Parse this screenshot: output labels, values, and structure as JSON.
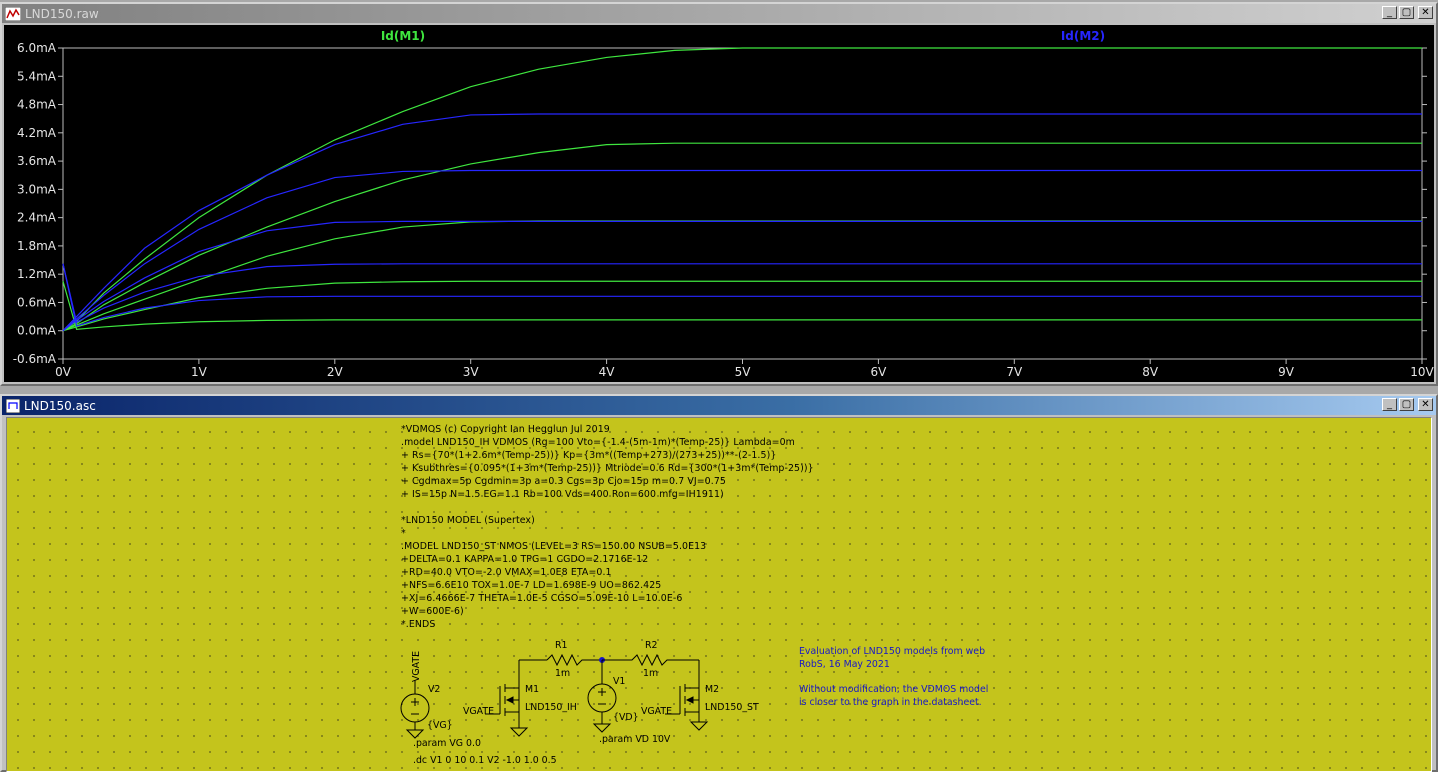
{
  "colors": {
    "trace_m1": "#3fe63f",
    "trace_m2": "#2626ff",
    "plot_bg": "#000000",
    "schematic_bg": "#c4c41c",
    "note": "#1717c8"
  },
  "plot_window": {
    "title": "LND150.raw",
    "icon": "waveform-icon",
    "buttons": {
      "minimize": "_",
      "restore": "▢",
      "close": "✕"
    }
  },
  "chart_data": {
    "type": "line",
    "xlim": [
      0,
      10
    ],
    "ylim": [
      -0.6,
      6.0
    ],
    "xticks": [
      "0V",
      "1V",
      "2V",
      "3V",
      "4V",
      "5V",
      "6V",
      "7V",
      "8V",
      "9V",
      "10V"
    ],
    "yticks": [
      "6.0mA",
      "5.4mA",
      "4.8mA",
      "4.2mA",
      "3.6mA",
      "3.0mA",
      "2.4mA",
      "1.8mA",
      "1.2mA",
      "0.6mA",
      "0.0mA",
      "-0.6mA"
    ],
    "x_values": [
      0,
      0.1,
      0.3,
      0.6,
      1.0,
      1.5,
      2.0,
      2.5,
      3.0,
      3.5,
      4.0,
      4.5,
      5.0,
      5.5,
      6.0,
      7.0,
      8.0,
      9.0,
      10.0
    ],
    "series": [
      {
        "name": "Id(M1)",
        "color": "#3fe63f",
        "values": [
          0,
          0.2,
          0.8,
          1.52,
          2.4,
          3.3,
          4.05,
          4.65,
          5.18,
          5.55,
          5.8,
          5.95,
          6.0,
          6.0,
          6.0,
          6.0,
          6.0,
          6.0,
          6.0
        ]
      },
      {
        "name": "Id(M1)",
        "color": "#3fe63f",
        "values": [
          0,
          0.15,
          0.55,
          1.02,
          1.6,
          2.2,
          2.74,
          3.2,
          3.54,
          3.78,
          3.95,
          3.98,
          3.98,
          3.98,
          3.98,
          3.98,
          3.98,
          3.98,
          3.98
        ]
      },
      {
        "name": "Id(M1)",
        "color": "#3fe63f",
        "values": [
          0,
          0.12,
          0.36,
          0.67,
          1.08,
          1.58,
          1.95,
          2.2,
          2.31,
          2.33,
          2.33,
          2.33,
          2.33,
          2.33,
          2.33,
          2.33,
          2.33,
          2.33,
          2.33
        ]
      },
      {
        "name": "Id(M1)",
        "color": "#3fe63f",
        "values": [
          0,
          0.08,
          0.25,
          0.45,
          0.7,
          0.9,
          1.01,
          1.04,
          1.05,
          1.05,
          1.05,
          1.05,
          1.05,
          1.05,
          1.05,
          1.05,
          1.05,
          1.05,
          1.05
        ]
      },
      {
        "name": "Id(M1)",
        "color": "#3fe63f",
        "values": [
          1.05,
          0.03,
          0.08,
          0.14,
          0.19,
          0.22,
          0.23,
          0.23,
          0.23,
          0.23,
          0.23,
          0.23,
          0.23,
          0.23,
          0.23,
          0.23,
          0.23,
          0.23,
          0.23
        ]
      },
      {
        "name": "Id(M2)",
        "color": "#2626ff",
        "values": [
          0,
          0.3,
          0.9,
          1.75,
          2.55,
          3.3,
          3.95,
          4.38,
          4.58,
          4.6,
          4.6,
          4.6,
          4.6,
          4.6,
          4.6,
          4.6,
          4.6,
          4.6,
          4.6
        ]
      },
      {
        "name": "Id(M2)",
        "color": "#2626ff",
        "values": [
          0,
          0.25,
          0.75,
          1.42,
          2.15,
          2.82,
          3.25,
          3.38,
          3.4,
          3.4,
          3.4,
          3.4,
          3.4,
          3.4,
          3.4,
          3.4,
          3.4,
          3.4,
          3.4
        ]
      },
      {
        "name": "Id(M2)",
        "color": "#2626ff",
        "values": [
          0,
          0.22,
          0.62,
          1.12,
          1.68,
          2.12,
          2.3,
          2.32,
          2.32,
          2.32,
          2.32,
          2.32,
          2.32,
          2.32,
          2.32,
          2.32,
          2.32,
          2.32,
          2.32
        ]
      },
      {
        "name": "Id(M2)",
        "color": "#2626ff",
        "values": [
          1.42,
          0.18,
          0.48,
          0.82,
          1.15,
          1.36,
          1.41,
          1.42,
          1.42,
          1.42,
          1.42,
          1.42,
          1.42,
          1.42,
          1.42,
          1.42,
          1.42,
          1.42,
          1.42
        ]
      },
      {
        "name": "Id(M2)",
        "color": "#2626ff",
        "values": [
          1.42,
          0.1,
          0.28,
          0.48,
          0.64,
          0.72,
          0.73,
          0.73,
          0.73,
          0.73,
          0.73,
          0.73,
          0.73,
          0.73,
          0.73,
          0.73,
          0.73,
          0.73,
          0.73
        ]
      }
    ],
    "legend": {
      "m1": "Id(M1)",
      "m2": "Id(M2)"
    },
    "grid": false
  },
  "schematic_window": {
    "title": "LND150.asc",
    "buttons": {
      "minimize": "_",
      "restore": "▢",
      "close": "✕"
    },
    "model_text": [
      "*VDMOS (c) Copyright Ian Hegglun Jul 2019",
      ".model LND150_IH VDMOS (Rg=100 Vto={-1.4-(5m-1m)*(Temp-25)} Lambda=0m",
      "+ Rs={70*(1+2.6m*(Temp-25))} Kp={3m*((Temp+273)/(273+25))**-(2-1.5)}",
      "+ Ksubthres={0.095*(1+3m*(Temp-25))} Mtriode=0.6 Rd={300*(1+3m*(Temp-25))}",
      "+ Cgdmax=5p Cgdmin=3p a=0.3 Cgs=3p Cjo=15p m=0.7 VJ=0.75",
      "+ IS=15p  N=1.5  EG=1.1 Rb=100 Vds=400 Ron=600 mfg=IH1911)",
      "",
      "*LND150 MODEL (Supertex)",
      "*",
      ".MODEL LND150_ST NMOS (LEVEL=3 RS=150.00 NSUB=5.0E13",
      "+DELTA=0.1 KAPPA=1.0 TPG=1 CGDO=2.1716E-12",
      "+RD=40.0 VTO=-2.0 VMAX=1.0E8 ETA=0.1",
      "+NFS=6.6E10 TOX=1.0E-7 LD=1.698E-9 UO=862.425",
      "+XJ=6.4666E-7 THETA=1.0E-5 CGSO=5.09E-10 L=10.0E-6",
      "+W=600E-6)",
      "*.ENDS"
    ],
    "components": {
      "vgate_net": "VGATE",
      "v2_name": "V2",
      "v2_value": "{VG}",
      "m1_name": "M1",
      "m1_gate": "VGATE",
      "m1_model": "LND150_IH",
      "r1_name": "R1",
      "r1_value": "1m",
      "v1_name": "V1",
      "v1_value": "{VD}",
      "r2_name": "R2",
      "r2_value": "1m",
      "m2_name": "M2",
      "m2_gate": "VGATE",
      "m2_model": "LND150_ST"
    },
    "directives": {
      "param_vg": ".param VG 0.0",
      "param_vd": ".param VD 10V",
      "dc": ".dc V1 0 10 0.1  V2 -1.0 1.0 0.5"
    },
    "notes": {
      "line1": "Evaluation of LND150 models from web",
      "line2": "RobS, 16 May 2021",
      "line3": "Without modification, the VDMOS model",
      "line4": "is closer to the graph in the datasheet."
    }
  }
}
